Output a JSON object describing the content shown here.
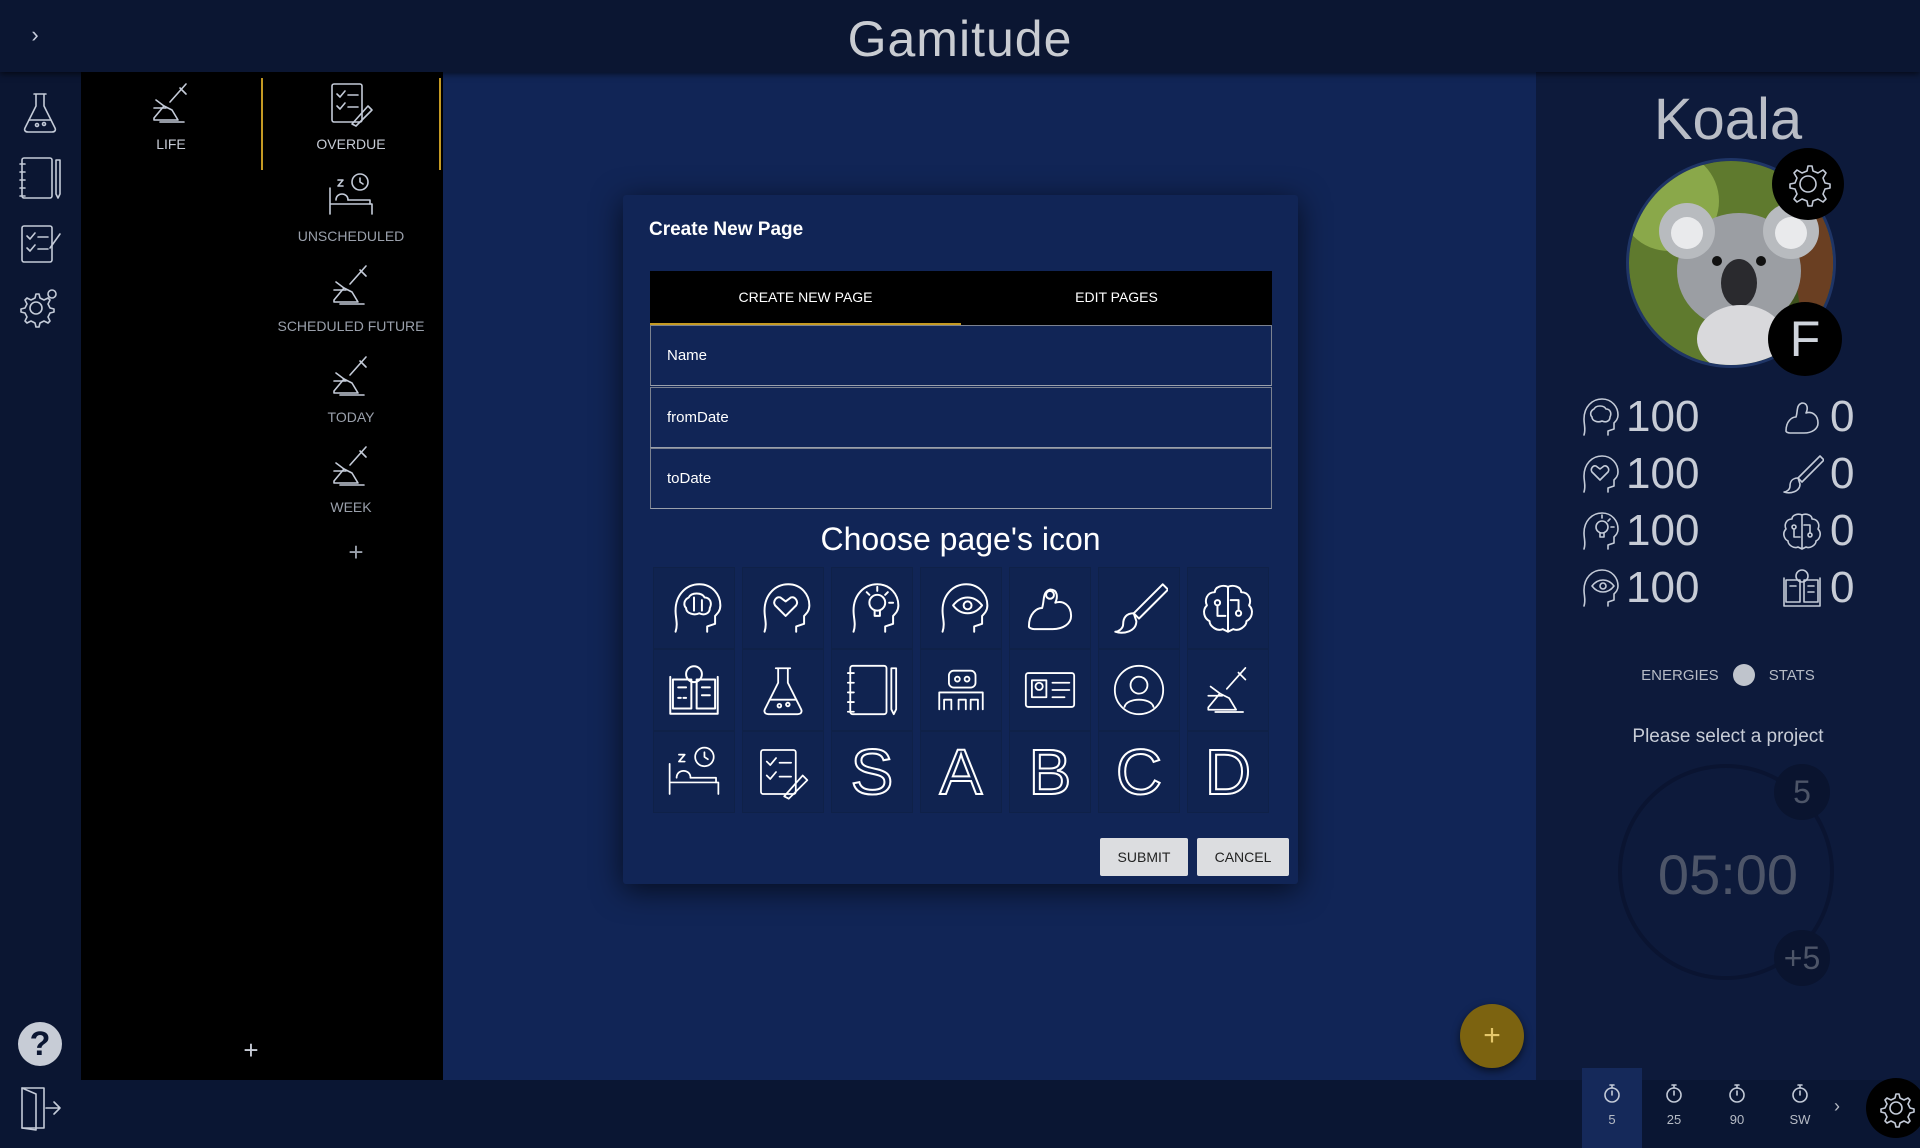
{
  "app": {
    "title": "Gamitude",
    "expand_glyph": "›"
  },
  "left_rail": {
    "items": [
      "flask-icon",
      "notebook-icon",
      "checklist-icon",
      "gear-icon"
    ],
    "help_glyph": "?",
    "logout_icon": "logout-icon"
  },
  "pages": {
    "items": [
      {
        "label": "LIFE",
        "icon": "runner-icon"
      },
      {
        "label": "OVERDUE",
        "icon": "checklist-icon"
      },
      {
        "label": "UNSCHEDULED",
        "icon": "sleep-icon"
      },
      {
        "label": "SCHEDULED FUTURE",
        "icon": "runner-icon"
      },
      {
        "label": "TODAY",
        "icon": "runner-icon"
      },
      {
        "label": "WEEK",
        "icon": "runner-icon"
      }
    ],
    "add_glyph": "+",
    "add_bottom_glyph": "+"
  },
  "fab": {
    "glyph": "+"
  },
  "profile": {
    "name": "Koala",
    "grade": "F",
    "stats_left": [
      {
        "icon": "brain-head-icon",
        "value": "100"
      },
      {
        "icon": "heart-head-icon",
        "value": "100"
      },
      {
        "icon": "bulb-head-icon",
        "value": "100"
      },
      {
        "icon": "eye-head-icon",
        "value": "100"
      }
    ],
    "stats_right": [
      {
        "icon": "muscle-icon",
        "value": "0"
      },
      {
        "icon": "brush-icon",
        "value": "0"
      },
      {
        "icon": "circuit-brain-icon",
        "value": "0"
      },
      {
        "icon": "book-icon",
        "value": "0"
      }
    ],
    "toggle_left": "ENERGIES",
    "toggle_right": "STATS",
    "project_message": "Please select a project",
    "timer": {
      "value": "05:00",
      "top_badge": "5",
      "plus_badge": "+5"
    },
    "presets": [
      "5",
      "25",
      "90",
      "SW"
    ],
    "preset_chevron": "›"
  },
  "dialog": {
    "title": "Create New Page",
    "tabs": [
      "CREATE NEW PAGE",
      "EDIT PAGES"
    ],
    "active_tab": "CREATE NEW PAGE",
    "fields": {
      "name": "Name",
      "from": "fromDate",
      "to": "toDate"
    },
    "choose_label": "Choose page's icon",
    "icons": [
      "brain-head-icon",
      "heart-head-icon",
      "bulb-head-icon",
      "eye-head-icon",
      "muscle-icon",
      "brush-icon",
      "circuit-brain-icon",
      "book-icon",
      "flask-icon",
      "notebook-icon",
      "robot-icon",
      "id-card-icon",
      "user-icon",
      "runner-icon",
      "sleep-icon",
      "checklist-icon"
    ],
    "letters": [
      "S",
      "A",
      "B",
      "C",
      "D"
    ],
    "submit": "SUBMIT",
    "cancel": "CANCEL"
  }
}
